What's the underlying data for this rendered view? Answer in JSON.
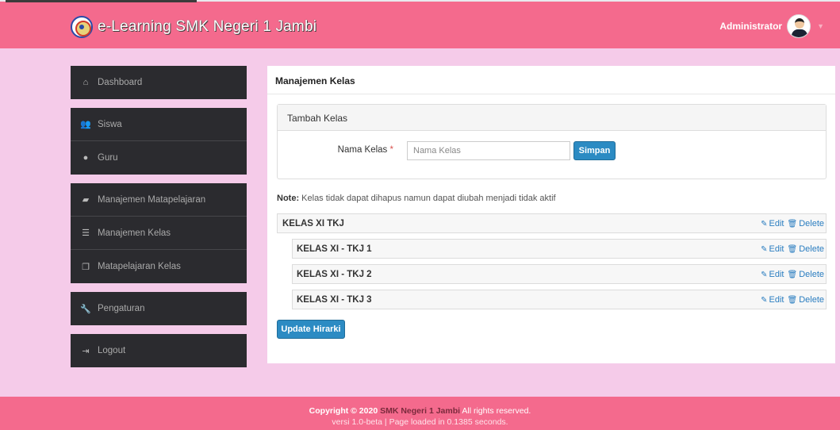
{
  "header": {
    "title": "e-Learning SMK Negeri 1 Jambi",
    "user": "Administrator",
    "caret": "▼"
  },
  "sidebar": {
    "groups": [
      [
        {
          "label": "Dashboard",
          "icon": "home-icon",
          "glyph": "⌂"
        }
      ],
      [
        {
          "label": "Siswa",
          "icon": "users-icon",
          "glyph": "👥"
        },
        {
          "label": "Guru",
          "icon": "user-icon",
          "glyph": "●"
        }
      ],
      [
        {
          "label": "Manajemen Matapelajaran",
          "icon": "book-icon",
          "glyph": "▰"
        },
        {
          "label": "Manajemen Kelas",
          "icon": "list-icon",
          "glyph": "☰"
        },
        {
          "label": "Matapelajaran Kelas",
          "icon": "copy-icon",
          "glyph": "❐"
        }
      ],
      [
        {
          "label": "Pengaturan",
          "icon": "wrench-icon",
          "glyph": "🔧"
        }
      ],
      [
        {
          "label": "Logout",
          "icon": "signout-icon",
          "glyph": "⇥"
        }
      ]
    ]
  },
  "main": {
    "title": "Manajemen Kelas",
    "form": {
      "panel_title": "Tambah Kelas",
      "label": "Nama Kelas",
      "required_mark": "*",
      "placeholder": "Nama Kelas",
      "value": "",
      "submit": "Simpan"
    },
    "note_prefix": "Note:",
    "note_text": " Kelas tidak dapat dihapus namun dapat diubah menjadi tidak aktif",
    "edit_label": "Edit",
    "delete_label": "Delete",
    "tree": [
      {
        "label": "KELAS XI TKJ",
        "level": 0
      },
      {
        "label": "KELAS XI - TKJ 1",
        "level": 1
      },
      {
        "label": "KELAS XI - TKJ 2",
        "level": 1
      },
      {
        "label": "KELAS XI - TKJ 3",
        "level": 1
      }
    ],
    "update_button": "Update Hirarki"
  },
  "footer": {
    "copyright": "Copyright © 2020",
    "school": "SMK Negeri 1 Jambi",
    "rights": "All rights reserved.",
    "version": "versi 1.0-beta | Page loaded in 0.1385 seconds."
  },
  "colors": {
    "topbar": "#f46a8d",
    "background": "#f5cbe9",
    "sidebar": "#2b2b2f",
    "primary_button": "#2c8bc3",
    "link": "#2a7dc0"
  }
}
